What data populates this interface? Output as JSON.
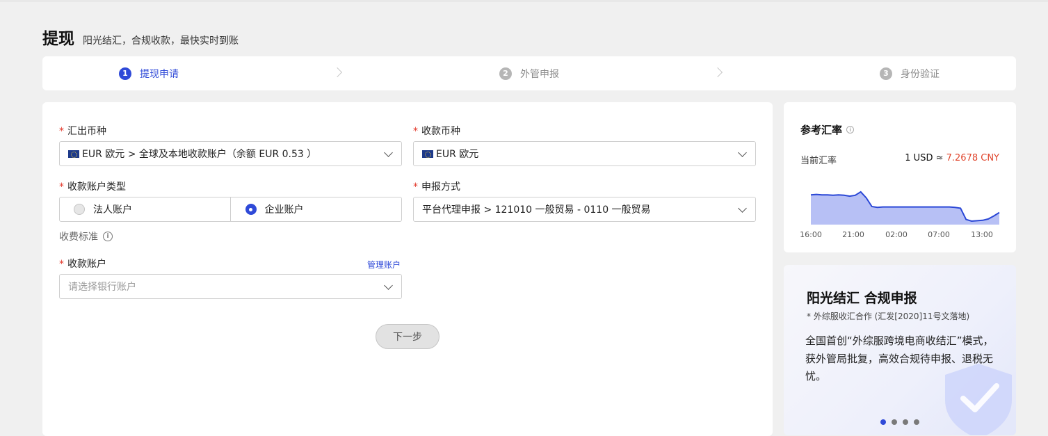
{
  "header": {
    "title": "提现",
    "subtitle": "阳光结汇，合规收款，最快实时到账"
  },
  "steps": [
    {
      "num": "1",
      "label": "提现申请",
      "state": "active"
    },
    {
      "num": "2",
      "label": "外管申报",
      "state": "inactive"
    },
    {
      "num": "3",
      "label": "身份验证",
      "state": "inactive"
    }
  ],
  "form": {
    "remit_currency": {
      "label": "汇出币种",
      "flag_icon": "eu-flag-icon",
      "value": "EUR 欧元 > 全球及本地收款账户（余额 EUR 0.53 ）"
    },
    "receive_currency": {
      "label": "收款币种",
      "flag_icon": "eu-flag-icon",
      "value": "EUR 欧元"
    },
    "account_type": {
      "label": "收款账户类型",
      "options": [
        "法人账户",
        "企业账户"
      ],
      "selected": "企业账户"
    },
    "declare_method": {
      "label": "申报方式",
      "value": "平台代理申报 > 121010 一般贸易 - 0110 一般贸易"
    },
    "fee_standard": {
      "label": "收费标准"
    },
    "receive_account": {
      "label": "收款账户",
      "manage_link": "管理账户",
      "placeholder": "请选择银行账户"
    },
    "next_button": "下一步"
  },
  "rate": {
    "title": "参考汇率",
    "current_label": "当前汇率",
    "value_prefix": "1 USD ≈ ",
    "value_number": "7.2678 CNY"
  },
  "chart_data": {
    "type": "area",
    "x_ticks": [
      "16:00",
      "21:00",
      "02:00",
      "07:00",
      "13:00"
    ],
    "values": [
      0.69,
      0.7,
      0.69,
      0.69,
      0.68,
      0.69,
      0.68,
      0.66,
      0.68,
      0.76,
      0.62,
      0.42,
      0.4,
      0.41,
      0.41,
      0.41,
      0.41,
      0.41,
      0.41,
      0.41,
      0.41,
      0.41,
      0.41,
      0.41,
      0.41,
      0.41,
      0.4,
      0.38,
      0.12,
      0.08,
      0.09,
      0.1,
      0.13,
      0.2,
      0.28
    ],
    "colors": {
      "line": "#2a47d6",
      "fill": "#b7c0f5"
    },
    "grid": false
  },
  "promo": {
    "title": "阳光结汇 合规申报",
    "note": "* 外综服收汇合作 (汇发[2020]11号文落地)",
    "body": "全国首创“外综服跨境电商收结汇”模式，获外管局批复，高效合规待申报、退税无忧。",
    "carousel_count": 4,
    "carousel_active": 0
  },
  "colors": {
    "accent": "#2f4ad8",
    "required": "#e33a2c",
    "rate_highlight": "#e0452d"
  }
}
